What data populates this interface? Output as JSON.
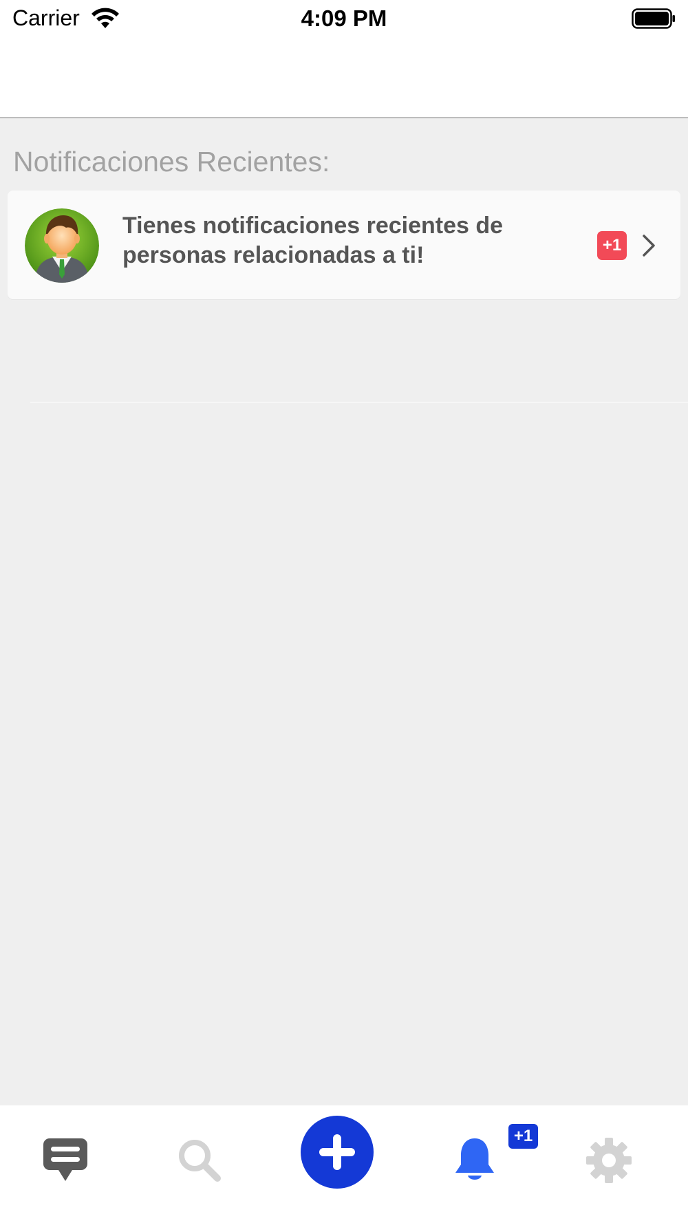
{
  "status_bar": {
    "carrier": "Carrier",
    "time": "4:09 PM"
  },
  "section": {
    "title": "Notificaciones Recientes:"
  },
  "notification": {
    "text": "Tienes notificaciones recientes de personas relacionadas a ti!",
    "badge": "+1",
    "avatar_icon": "person-avatar-icon"
  },
  "tab_bar": {
    "items": [
      {
        "icon": "messages-icon"
      },
      {
        "icon": "search-icon"
      },
      {
        "icon": "add-icon"
      },
      {
        "icon": "bell-icon",
        "badge": "+1"
      },
      {
        "icon": "gear-icon"
      }
    ]
  },
  "colors": {
    "accent_blue": "#1439d6",
    "bell_blue": "#2f66f4",
    "badge_red": "#f24a57",
    "inactive_gray": "#d3d3d3",
    "dark_gray": "#555555",
    "background": "#efefef"
  }
}
